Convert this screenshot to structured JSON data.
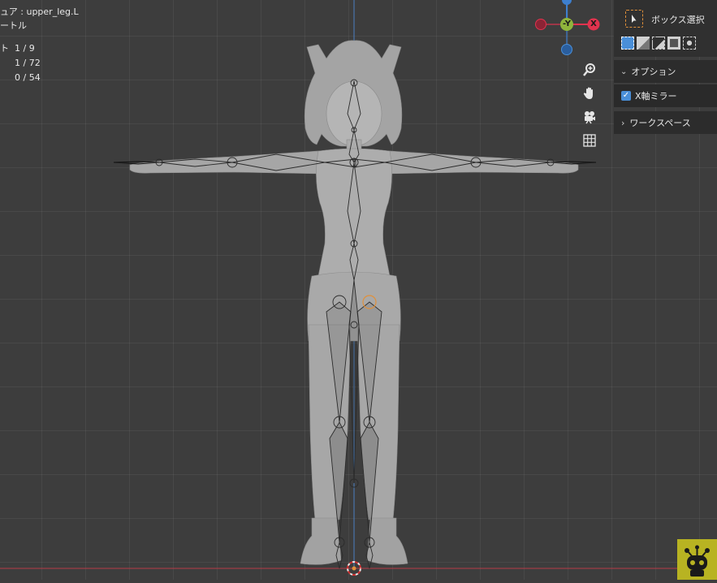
{
  "stats": {
    "line0": "...",
    "armature_line": "ュア : upper_leg.L",
    "mode_line": "ートル",
    "bones_label": "ト",
    "bones_value": "1 / 9",
    "value2": "1 / 72",
    "value3": "0 / 54"
  },
  "gizmo": {
    "y_label": "-Y",
    "x_label": "X",
    "colors": {
      "x": "#e0334e",
      "y": "#8fb53c",
      "z": "#3d7fcf"
    }
  },
  "view_controls": [
    "zoom-icon",
    "pan-hand-icon",
    "camera-icon",
    "grid-icon"
  ],
  "toolbar": {
    "active_tool_label": "ボックス選択"
  },
  "options_panel": {
    "header": "オプション",
    "x_mirror_label": "X軸ミラー",
    "x_mirror_checked": true
  },
  "workspace_panel": {
    "header": "ワークスペース"
  },
  "colors": {
    "accent": "#4a8fd8",
    "background": "#3d3d3d",
    "panel": "#2c2c2c",
    "logo_bg": "#b8b322"
  }
}
